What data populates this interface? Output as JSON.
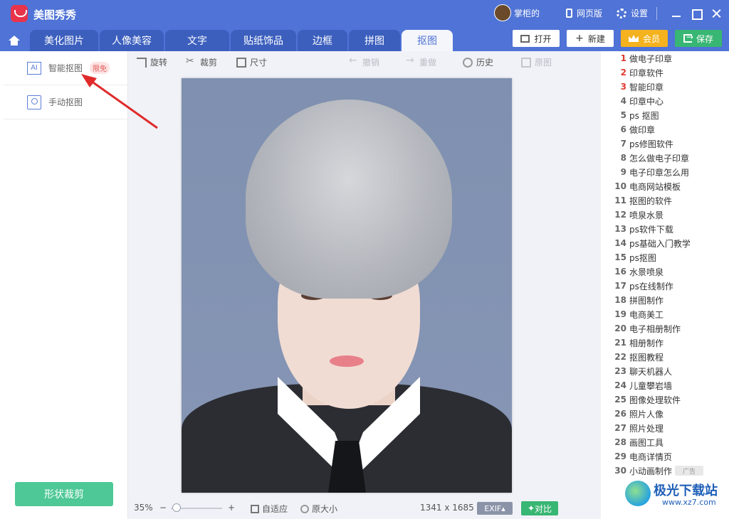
{
  "app": {
    "title": "美图秀秀"
  },
  "titlebar": {
    "user_name": "掌柜的",
    "web_version": "网页版",
    "settings": "设置"
  },
  "nav": {
    "tabs": [
      {
        "label": "美化图片"
      },
      {
        "label": "人像美容"
      },
      {
        "label": "文字"
      },
      {
        "label": "贴纸饰品"
      },
      {
        "label": "边框"
      },
      {
        "label": "拼图"
      },
      {
        "label": "抠图"
      }
    ],
    "active": "抠图",
    "open": "打开",
    "new": "新建",
    "vip": "会员",
    "save": "保存"
  },
  "left_panel": {
    "smart_cutout": "智能抠图",
    "smart_badge": "限免",
    "smart_icon_text": "AI",
    "manual_cutout": "手动抠图",
    "shape_crop": "形状裁剪"
  },
  "toolbar": {
    "rotate": "旋转",
    "crop": "裁剪",
    "size": "尺寸",
    "undo": "撤销",
    "redo": "重做",
    "history": "历史",
    "original": "原图"
  },
  "statusbar": {
    "zoom": "35%",
    "zoom_minus": "−",
    "zoom_plus": "+",
    "fit": "自适应",
    "actual_size": "原大小",
    "dimensions": "1341 x 1685",
    "exif": "EXIF",
    "compare": "对比"
  },
  "ad_list": {
    "items": [
      {
        "num": "1",
        "text": "做电子印章"
      },
      {
        "num": "2",
        "text": "印章软件"
      },
      {
        "num": "3",
        "text": "智能印章"
      },
      {
        "num": "4",
        "text": "印章中心"
      },
      {
        "num": "5",
        "text": "ps 抠图"
      },
      {
        "num": "6",
        "text": "做印章"
      },
      {
        "num": "7",
        "text": "ps修图软件"
      },
      {
        "num": "8",
        "text": "怎么做电子印章"
      },
      {
        "num": "9",
        "text": "电子印章怎么用"
      },
      {
        "num": "10",
        "text": "电商网站模板"
      },
      {
        "num": "11",
        "text": "抠图的软件"
      },
      {
        "num": "12",
        "text": "喷泉水景"
      },
      {
        "num": "13",
        "text": "ps软件下载"
      },
      {
        "num": "14",
        "text": "ps基础入门教学"
      },
      {
        "num": "15",
        "text": "ps抠图"
      },
      {
        "num": "16",
        "text": "水景喷泉"
      },
      {
        "num": "17",
        "text": "ps在线制作"
      },
      {
        "num": "18",
        "text": "拼图制作"
      },
      {
        "num": "19",
        "text": "电商美工"
      },
      {
        "num": "20",
        "text": "电子相册制作"
      },
      {
        "num": "21",
        "text": "相册制作"
      },
      {
        "num": "22",
        "text": "抠图教程"
      },
      {
        "num": "23",
        "text": "聊天机器人"
      },
      {
        "num": "24",
        "text": "儿童攀岩墙"
      },
      {
        "num": "25",
        "text": "图像处理软件"
      },
      {
        "num": "26",
        "text": "照片人像"
      },
      {
        "num": "27",
        "text": "照片处理"
      },
      {
        "num": "28",
        "text": "画图工具"
      },
      {
        "num": "29",
        "text": "电商详情页"
      },
      {
        "num": "30",
        "text": "小动画制作"
      }
    ],
    "ad_tag": "广告"
  },
  "watermark": {
    "title": "极光下载站",
    "url": "www.xz7.com"
  },
  "colors": {
    "brand_blue": "#4f73d6",
    "save_green": "#38b673",
    "vip_gold": "#f4b21e",
    "annotation_red": "#e02a2a"
  }
}
